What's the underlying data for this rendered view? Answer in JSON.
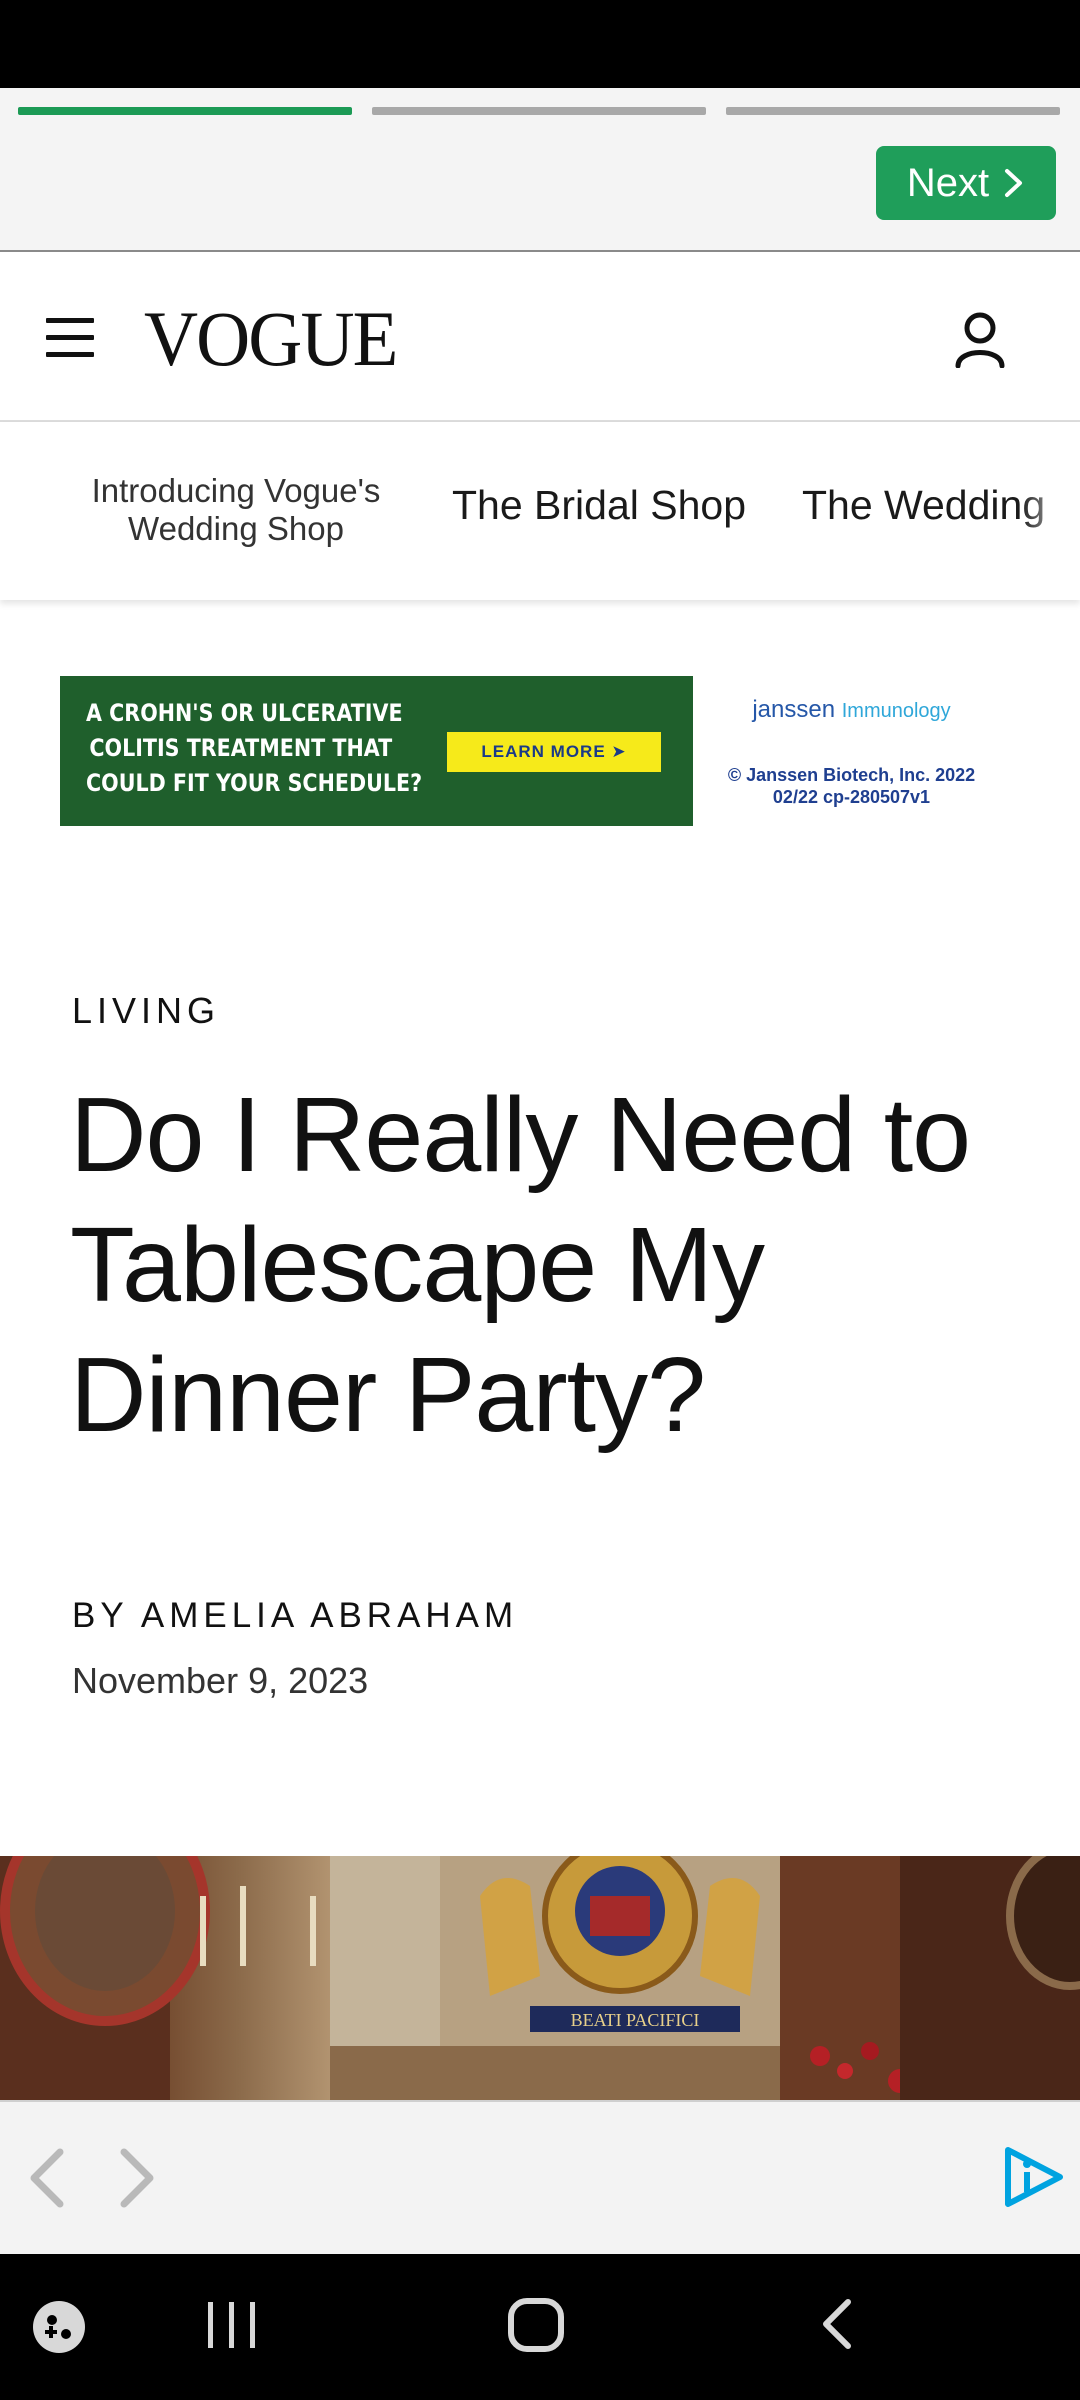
{
  "story_header": {
    "progress_segments": [
      {
        "state": "complete"
      },
      {
        "state": "pending"
      },
      {
        "state": "pending"
      }
    ],
    "next_label": "Next"
  },
  "site_header": {
    "logo": "VOGUE",
    "menu_icon": "hamburger-menu-icon",
    "account_icon": "user-account-icon"
  },
  "nav": {
    "promo": "Introducing Vogue's Wedding Shop",
    "items": [
      {
        "label": "The Bridal Shop"
      },
      {
        "label": "The Wedding"
      }
    ]
  },
  "ad": {
    "headline": [
      "A CROHN'S OR ULCERATIVE",
      "COLITIS TREATMENT THAT",
      "COULD FIT YOUR SCHEDULE?"
    ],
    "cta": "LEARN MORE ➤",
    "brand": "janssen",
    "brand_sub": "Immunology",
    "legal_line1": "© Janssen Biotech, Inc. 2022",
    "legal_line2": "02/22 cp-280507v1"
  },
  "article": {
    "section": "LIVING",
    "headline": "Do I Really Need to Tablescape My Dinner Party?",
    "byline_prefix": "BY",
    "author": "AMELIA ABRAHAM",
    "date": "November 9, 2023"
  },
  "hero_image": {
    "motto": "BEATI PACIFICI"
  },
  "bottom_bar": {
    "prev_icon": "chevron-left-icon",
    "next_icon": "chevron-right-icon",
    "ad_icon": "adchoices-icon"
  },
  "colors": {
    "accent_green": "#1f9e5a",
    "ad_green": "#1f5f2c",
    "ad_yellow": "#f6ea1a",
    "adchoices_blue": "#00a3e0"
  }
}
